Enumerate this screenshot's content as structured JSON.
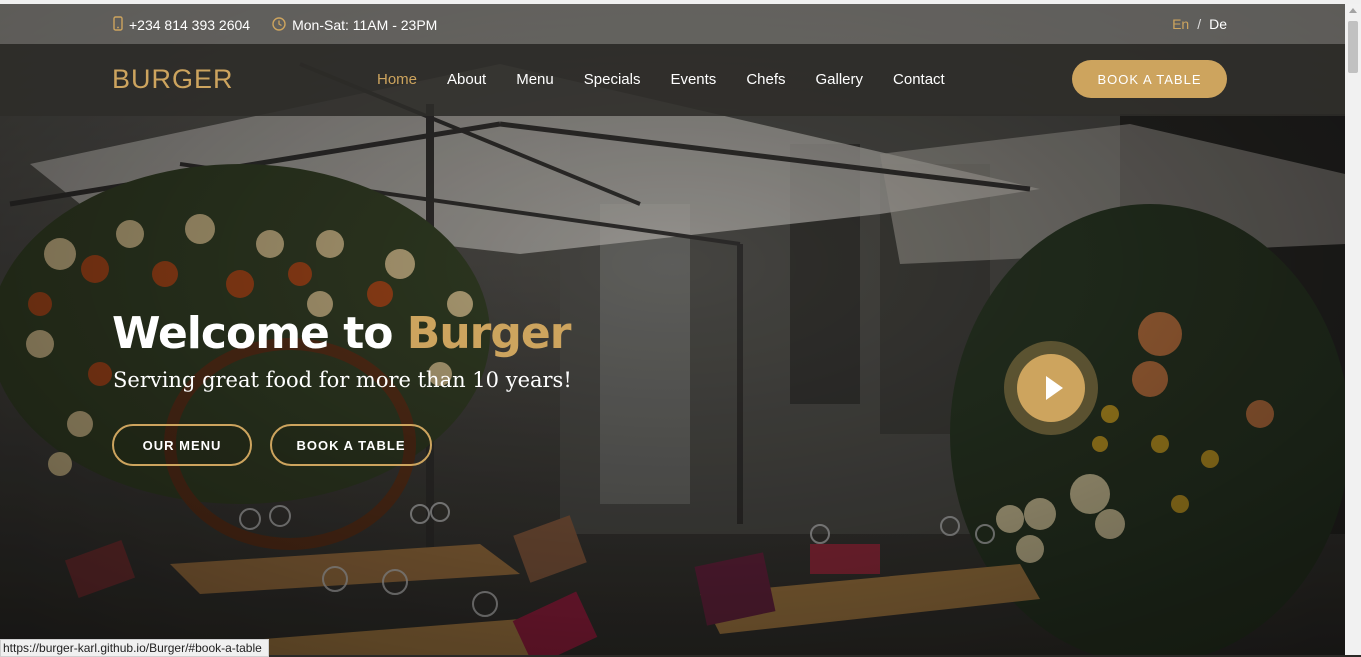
{
  "topbar": {
    "phone": "+234 814 393 2604",
    "hours": "Mon-Sat: 11AM - 23PM",
    "icons": {
      "phone": "phone-icon",
      "clock": "clock-icon"
    },
    "lang_active": "En",
    "lang_sep": "/",
    "lang_other": "De"
  },
  "header": {
    "logo": "BURGER",
    "nav": [
      "Home",
      "About",
      "Menu",
      "Specials",
      "Events",
      "Chefs",
      "Gallery",
      "Contact"
    ],
    "active_nav": "Home",
    "book_button": "BOOK A TABLE"
  },
  "hero": {
    "title_part1": "Welcome to ",
    "title_accent": "Burger",
    "subtitle": "Serving great food for more than 10 years!",
    "btn_menu": "OUR MENU",
    "btn_book": "BOOK A TABLE",
    "play_icon": "play-icon"
  },
  "status_url": "https://burger-karl.github.io/Burger/#book-a-table",
  "colors": {
    "accent": "#cda45e",
    "header_bg": "#2d2c29"
  }
}
